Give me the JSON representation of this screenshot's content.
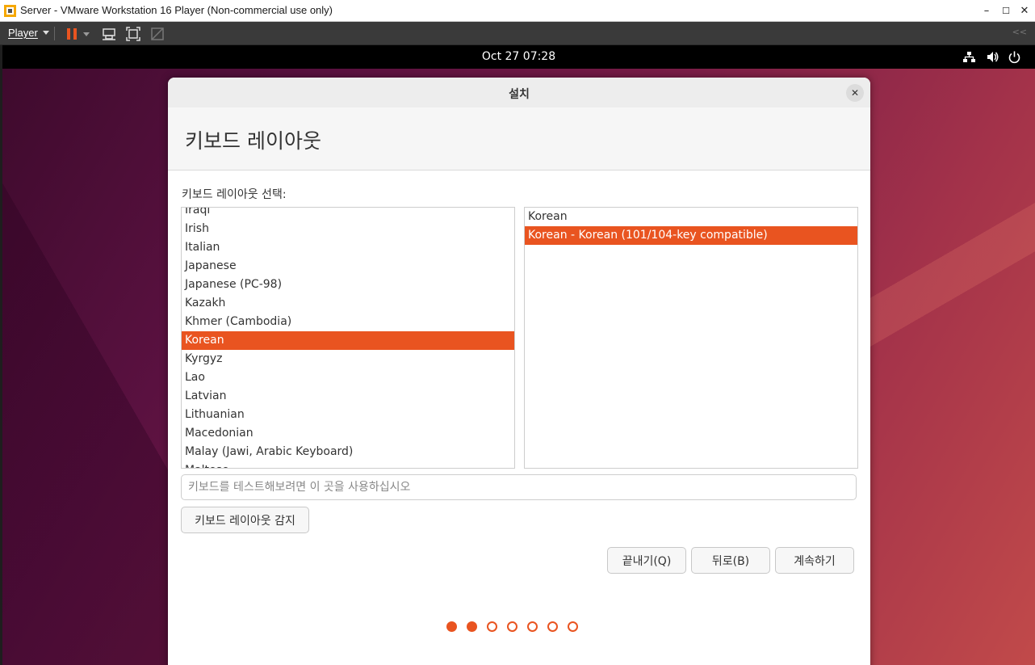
{
  "window": {
    "title": "Server - VMware Workstation 16 Player (Non-commercial use only)",
    "minimize": "–",
    "maximize": "☐",
    "close": "✕"
  },
  "toolbar": {
    "player_label": "Player",
    "collapse": "<<"
  },
  "topbar": {
    "datetime": "Oct 27  07:28"
  },
  "dialog": {
    "title": "설치",
    "close": "✕",
    "page_title": "키보드 레이아웃",
    "select_label": "키보드 레이아웃 선택:",
    "layouts": [
      {
        "label": "Iraqi",
        "selected": false
      },
      {
        "label": "Irish",
        "selected": false
      },
      {
        "label": "Italian",
        "selected": false
      },
      {
        "label": "Japanese",
        "selected": false
      },
      {
        "label": "Japanese (PC-98)",
        "selected": false
      },
      {
        "label": "Kazakh",
        "selected": false
      },
      {
        "label": "Khmer (Cambodia)",
        "selected": false
      },
      {
        "label": "Korean",
        "selected": true
      },
      {
        "label": "Kyrgyz",
        "selected": false
      },
      {
        "label": "Lao",
        "selected": false
      },
      {
        "label": "Latvian",
        "selected": false
      },
      {
        "label": "Lithuanian",
        "selected": false
      },
      {
        "label": "Macedonian",
        "selected": false
      },
      {
        "label": "Malay (Jawi, Arabic Keyboard)",
        "selected": false
      },
      {
        "label": "Maltese",
        "selected": false
      }
    ],
    "variants": [
      {
        "label": "Korean",
        "selected": false
      },
      {
        "label": "Korean - Korean (101/104-key compatible)",
        "selected": true
      }
    ],
    "test_placeholder": "키보드를 테스트해보려면 이 곳을 사용하십시오",
    "detect_button": "키보드 레이아웃 감지",
    "quit_button": "끝내기(Q)",
    "back_button": "뒤로(B)",
    "continue_button": "계속하기",
    "progress": {
      "current_step": 2,
      "total_steps": 7
    }
  },
  "colors": {
    "accent": "#e95420",
    "dialog_bg": "#ffffff",
    "topbar_bg": "#000000"
  }
}
